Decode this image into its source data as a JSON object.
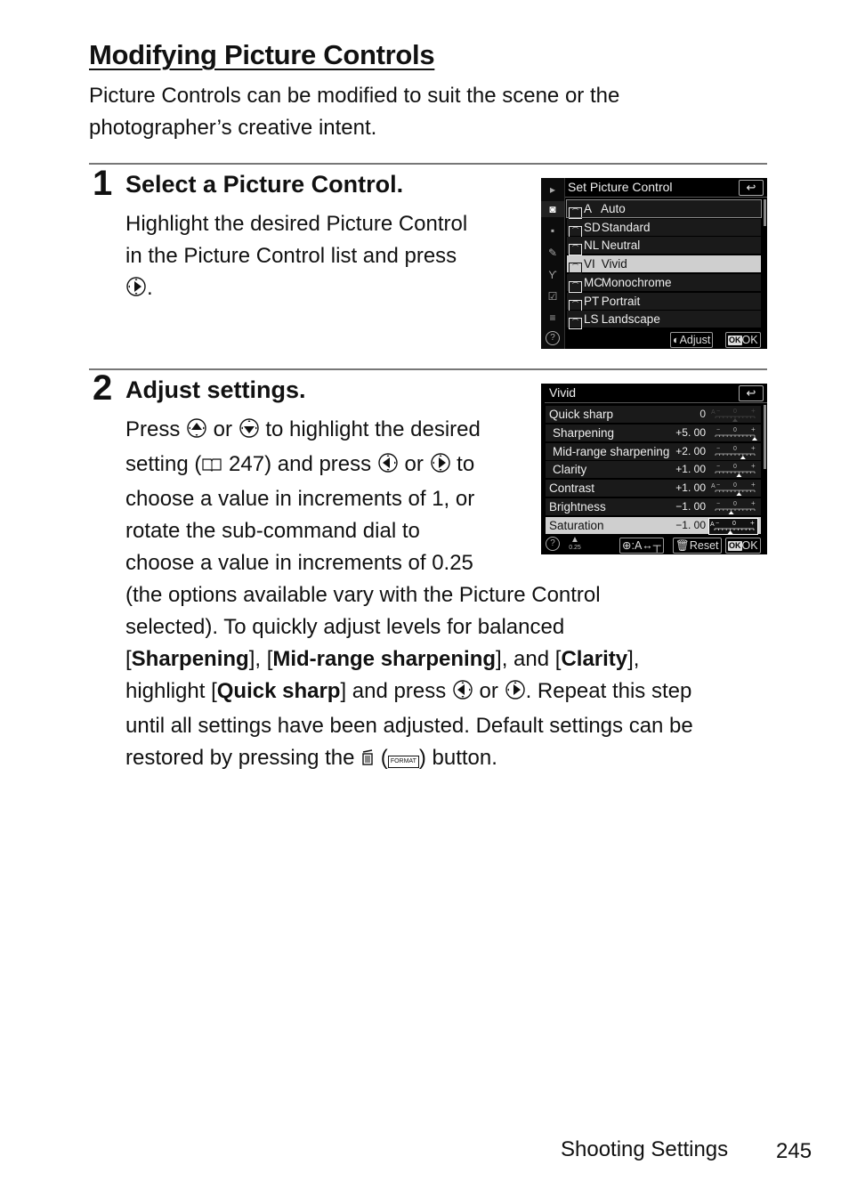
{
  "page": {
    "title": "Modifying Picture Controls",
    "intro": "Picture Controls can be modified to suit the scene or the photographer’s creative intent.",
    "footer_section": "Shooting Settings",
    "page_number": "245"
  },
  "step1": {
    "number": "1",
    "heading": "Select a Picture Control.",
    "lines": [
      "Highlight the desired Picture Control",
      "in the Picture Control list and press",
      "."
    ],
    "icons": [
      "multi-selector-right-icon"
    ]
  },
  "screen1": {
    "title": "Set Picture Control",
    "back_icon": "return-icon",
    "sidebar_icons": [
      "playback-icon",
      "camera-icon",
      "movie-icon",
      "pencil-icon",
      "wrench-icon",
      "checkbox-icon",
      "my-menu-icon",
      "help-icon"
    ],
    "items": [
      {
        "code": "A",
        "name": "Auto",
        "state": "outlined"
      },
      {
        "code": "SD",
        "name": "Standard",
        "state": ""
      },
      {
        "code": "NL",
        "name": "Neutral",
        "state": ""
      },
      {
        "code": "VI",
        "name": "Vivid",
        "state": "highlighted"
      },
      {
        "code": "MC",
        "name": "Monochrome",
        "state": ""
      },
      {
        "code": "PT",
        "name": "Portrait",
        "state": ""
      },
      {
        "code": "LS",
        "name": "Landscape",
        "state": ""
      }
    ],
    "adjust_label": "Adjust",
    "ok_badge": "OK",
    "ok_label": "OK",
    "help": "?"
  },
  "step2": {
    "number": "2",
    "heading": "Adjust settings.",
    "l1a": "Press ",
    "l1b": " or ",
    "l1c": " to highlight the desired",
    "l2a": "setting (",
    "l2b": "  247) and press ",
    "l2c": " or ",
    "l2d": " to",
    "l3": "choose a value in increments of 1, or",
    "l4": "rotate the sub-command dial to",
    "l5": "choose a value in increments of 0.25",
    "l6": "(the options available vary with the Picture Control",
    "l7": "selected). To quickly adjust levels for balanced",
    "l8a": "[",
    "l8b": "Sharpening",
    "l8c": "], [",
    "l8d": "Mid-range sharpening",
    "l8e": "], and [",
    "l8f": "Clarity",
    "l8g": "],",
    "l9a": "highlight [",
    "l9b": "Quick sharp",
    "l9c": "] and press ",
    "l9d": " or ",
    "l9e": ". Repeat this step",
    "l10": "until all settings have been adjusted. Default settings can be",
    "l11a": "restored by pressing the ",
    "l11b": " (",
    "l11c": ") button.",
    "format_label": "FORMAT"
  },
  "screen2": {
    "title": "Vivid",
    "back_icon": "return-icon",
    "rows": [
      {
        "label": "Quick sharp",
        "value": "0",
        "sub": false,
        "auto": true,
        "dim": true,
        "level": 0
      },
      {
        "label": "Sharpening",
        "value": "+5. 00",
        "sub": true,
        "auto": false,
        "dim": false,
        "level": 5
      },
      {
        "label": "Mid-range sharpening",
        "value": "+2. 00",
        "sub": true,
        "auto": false,
        "dim": false,
        "level": 2
      },
      {
        "label": "Clarity",
        "value": "+1. 00",
        "sub": true,
        "auto": false,
        "dim": false,
        "level": 1
      },
      {
        "label": "Contrast",
        "value": "+1. 00",
        "sub": false,
        "auto": true,
        "dim": false,
        "level": 1
      },
      {
        "label": "Brightness",
        "value": "−1. 00",
        "sub": false,
        "auto": false,
        "dim": false,
        "level": -1
      },
      {
        "label": "Saturation",
        "value": "−1. 00",
        "sub": false,
        "auto": true,
        "dim": false,
        "level": -1,
        "highlighted": true
      }
    ],
    "step_value": "0.25",
    "zoom_hint": ":A↔",
    "reset_label": "Reset",
    "ok_badge": "OK",
    "ok_label": "OK",
    "help": "?"
  }
}
